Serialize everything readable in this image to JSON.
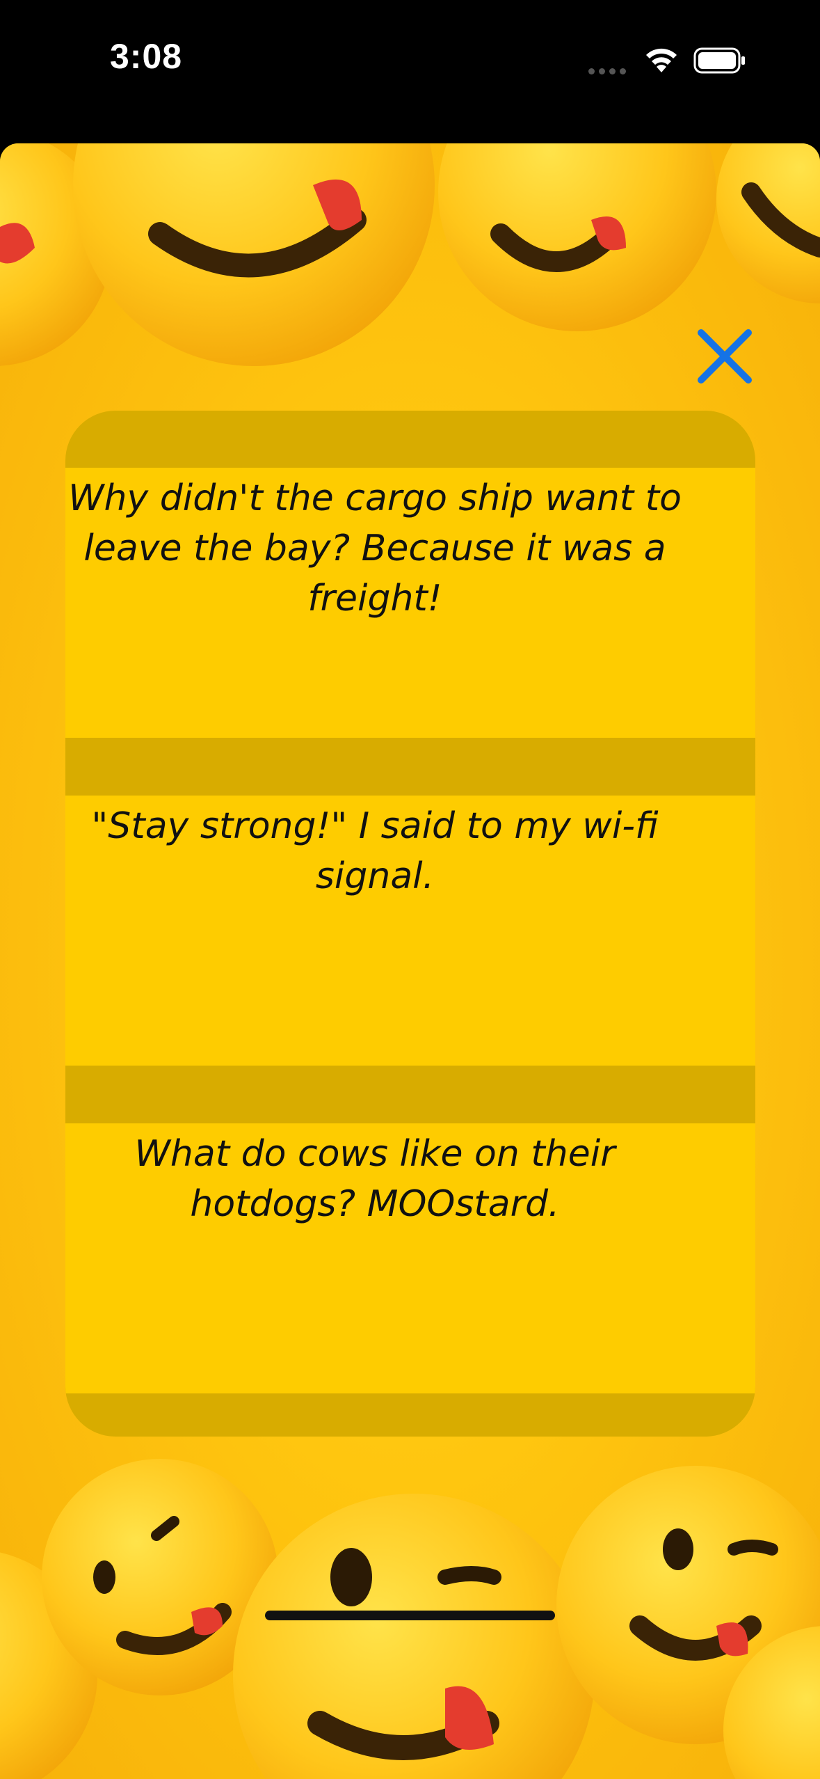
{
  "status_bar": {
    "time": "3:08"
  },
  "colors": {
    "background_yellow": "#ffc60f",
    "list_band": "#d8ac00",
    "cell": "#fecc00",
    "close_icon": "#1573e6",
    "text": "#111111"
  },
  "close": {
    "icon": "close-x-icon"
  },
  "jokes": [
    {
      "text": "Why didn't the cargo ship want to leave the bay? Because it was a freight!"
    },
    {
      "text": "\"Stay strong!\" I said to my wi-fi signal."
    },
    {
      "text": "What do cows like on their hotdogs? MOOstard."
    }
  ]
}
